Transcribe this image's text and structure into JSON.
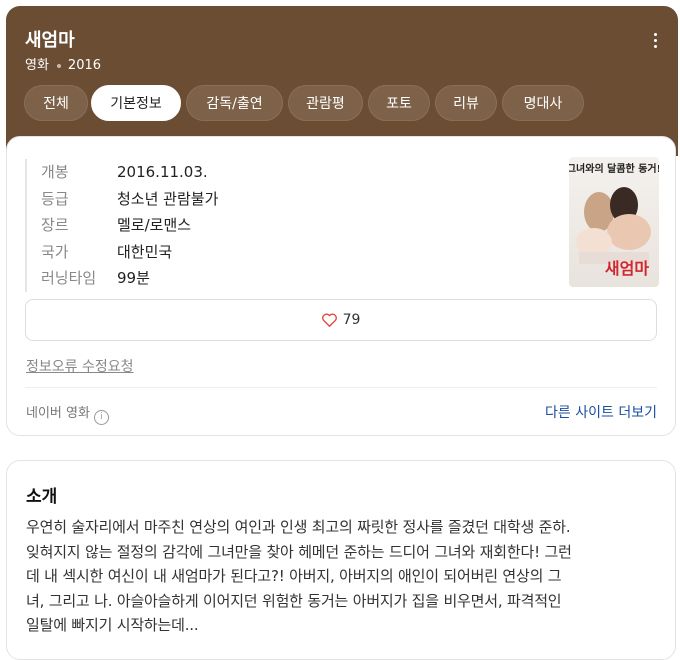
{
  "header": {
    "title": "새엄마",
    "category": "영화",
    "year": "2016"
  },
  "tabs": [
    {
      "label": "전체",
      "active": false
    },
    {
      "label": "기본정보",
      "active": true
    },
    {
      "label": "감독/출연",
      "active": false
    },
    {
      "label": "관람평",
      "active": false
    },
    {
      "label": "포토",
      "active": false
    },
    {
      "label": "리뷰",
      "active": false
    },
    {
      "label": "명대사",
      "active": false
    }
  ],
  "info": [
    {
      "key": "개봉",
      "value": "2016.11.03."
    },
    {
      "key": "등급",
      "value": "청소년 관람불가"
    },
    {
      "key": "장르",
      "value": "멜로/로맨스"
    },
    {
      "key": "국가",
      "value": "대한민국"
    },
    {
      "key": "러닝타임",
      "value": "99분"
    }
  ],
  "poster": {
    "tagline": "그녀와의 달콤한 동거!",
    "title_text": "새엄마"
  },
  "like": {
    "count": "79"
  },
  "report_link": "정보오류 수정요청",
  "source": {
    "label": "네이버 영화",
    "info_icon": "i"
  },
  "other_sites": "다른 사이트 더보기",
  "intro": {
    "title": "소개",
    "lines": [
      "우연히 술자리에서 마주친 연상의 여인과 인생 최고의 짜릿한 정사를 즐겼던 대학생 준하.",
      "잊혀지지 않는 절정의 감각에 그녀만을 찾아 헤메던 준하는 드디어 그녀와 재회한다! 그런",
      "데 내 섹시한 여신이 내 새엄마가 된다고?! 아버지, 아버지의 애인이 되어버린 연상의 그",
      "녀, 그리고 나. 아슬아슬하게 이어지던 위험한 동거는 아버지가 집을 비우면서, 파격적인",
      "일탈에 빠지기 시작하는데..."
    ]
  },
  "colors": {
    "header_bg": "#6b4d33",
    "link": "#1b4fa0",
    "heart": "#e4463b"
  }
}
